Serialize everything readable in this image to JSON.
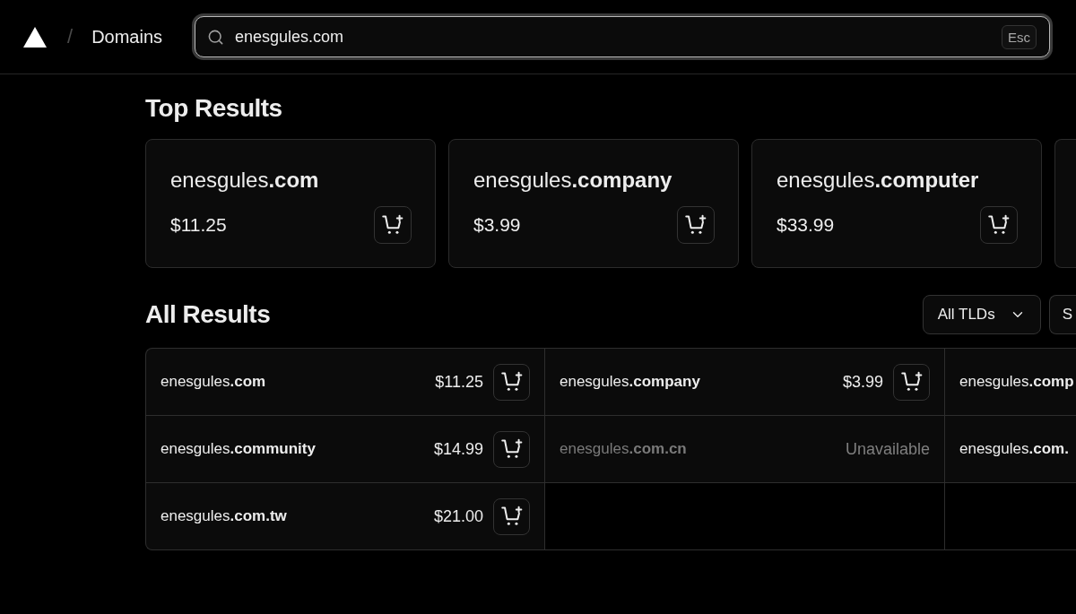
{
  "header": {
    "separator": "/",
    "title": "Domains"
  },
  "search": {
    "value": "enesgules.com",
    "shortcut": "Esc"
  },
  "top_results": {
    "title": "Top Results",
    "more": true,
    "cards": [
      {
        "domain": "enesgules**.com**",
        "price": "$11.25"
      },
      {
        "domain": "enesgules**.company**",
        "price": "$3.99"
      },
      {
        "domain": "enesgules**.computer**",
        "price": "$33.99"
      }
    ]
  },
  "all_results": {
    "title": "All Results",
    "filters": [
      {
        "kind": "dropdown",
        "label": "All TLDs"
      },
      {
        "kind": "button",
        "label": "S"
      }
    ],
    "cells": [
      {
        "domain": "enesgules**.com**",
        "price": "$11.25",
        "available": true
      },
      {
        "domain": "enesgules**.company**",
        "price": "$3.99",
        "available": true
      },
      {
        "domain": "enesgules**.comp**",
        "available": true
      },
      {
        "domain": "enesgules**.community**",
        "price": "$14.99",
        "available": true
      },
      {
        "domain": "enesgules**.com.cn**",
        "status": "Unavailable",
        "available": false
      },
      {
        "domain": "enesgules**.com.**",
        "available": true
      },
      {
        "domain": "enesgules**.com.tw**",
        "price": "$21.00",
        "available": true
      }
    ]
  }
}
